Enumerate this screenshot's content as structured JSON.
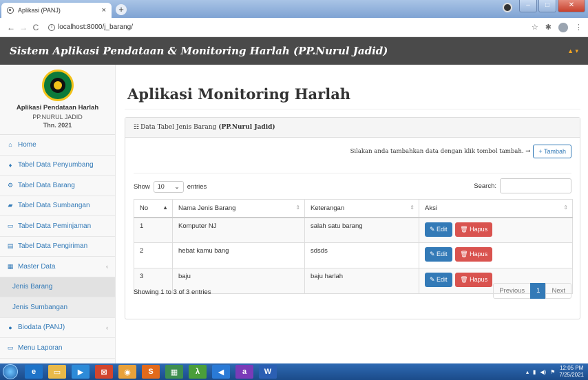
{
  "browser": {
    "tab_title": "Aplikasi (PANJ)",
    "tab_close": "×",
    "new_tab": "+",
    "url": "localhost:8000/j_barang/"
  },
  "header": {
    "brand": "Sistem Aplikasi Pendataan & Monitoring Harlah (PP.Nurul Jadid)",
    "user_menu": "▲ ▾"
  },
  "sidebar": {
    "app_name": "Aplikasi Pendataan Harlah",
    "org": "PP.NURUL JADID",
    "year": "Thn. 2021",
    "items": [
      {
        "label": "Home",
        "icon": "⌂"
      },
      {
        "label": "Tabel Data Penyumbang",
        "icon": "♦"
      },
      {
        "label": "Tabel Data Barang",
        "icon": "⚙"
      },
      {
        "label": "Tabel Data Sumbangan",
        "icon": "▰"
      },
      {
        "label": "Tabel Data Peminjaman",
        "icon": "▭"
      },
      {
        "label": "Tabel Data Pengiriman",
        "icon": "▤"
      },
      {
        "label": "Master Data",
        "icon": "▦",
        "caret": "‹"
      },
      {
        "label": "Jenis Barang"
      },
      {
        "label": "Jenis Sumbangan"
      },
      {
        "label": "Biodata (PANJ)",
        "icon": "●",
        "caret": "‹"
      },
      {
        "label": "Menu Laporan",
        "icon": "▭"
      }
    ]
  },
  "main": {
    "page_title": "Aplikasi Monitoring Harlah",
    "panel_title_prefix": "Data Tabel Jenis Barang",
    "panel_title_bold": "(PP.Nurul Jadid)",
    "add_hint": "Silakan anda tambahkan data dengan klik tombol tambah. ➞",
    "add_button": "+ Tambah",
    "show_label": "Show",
    "entries_value": "10",
    "entries_label": "entries",
    "search_label": "Search:",
    "columns": [
      "No",
      "Nama Jenis Barang",
      "Keterangan",
      "Aksi"
    ],
    "rows": [
      {
        "no": "1",
        "nama": "Komputer NJ",
        "ket": "salah satu barang"
      },
      {
        "no": "2",
        "nama": "hebat kamu bang",
        "ket": "sdsds"
      },
      {
        "no": "3",
        "nama": "baju",
        "ket": "baju harlah"
      }
    ],
    "edit_label": "✎ Edit",
    "delete_label": "🗑 Hapus",
    "info": "Showing 1 to 3 of 3 entries",
    "pager": {
      "previous": "Previous",
      "current": "1",
      "next": "Next"
    }
  },
  "taskbar": {
    "time": "12:05 PM",
    "date": "7/25/2021"
  },
  "colors": {
    "primary": "#337ab7",
    "danger": "#d9534f",
    "header_bg": "#4a4a4a"
  }
}
